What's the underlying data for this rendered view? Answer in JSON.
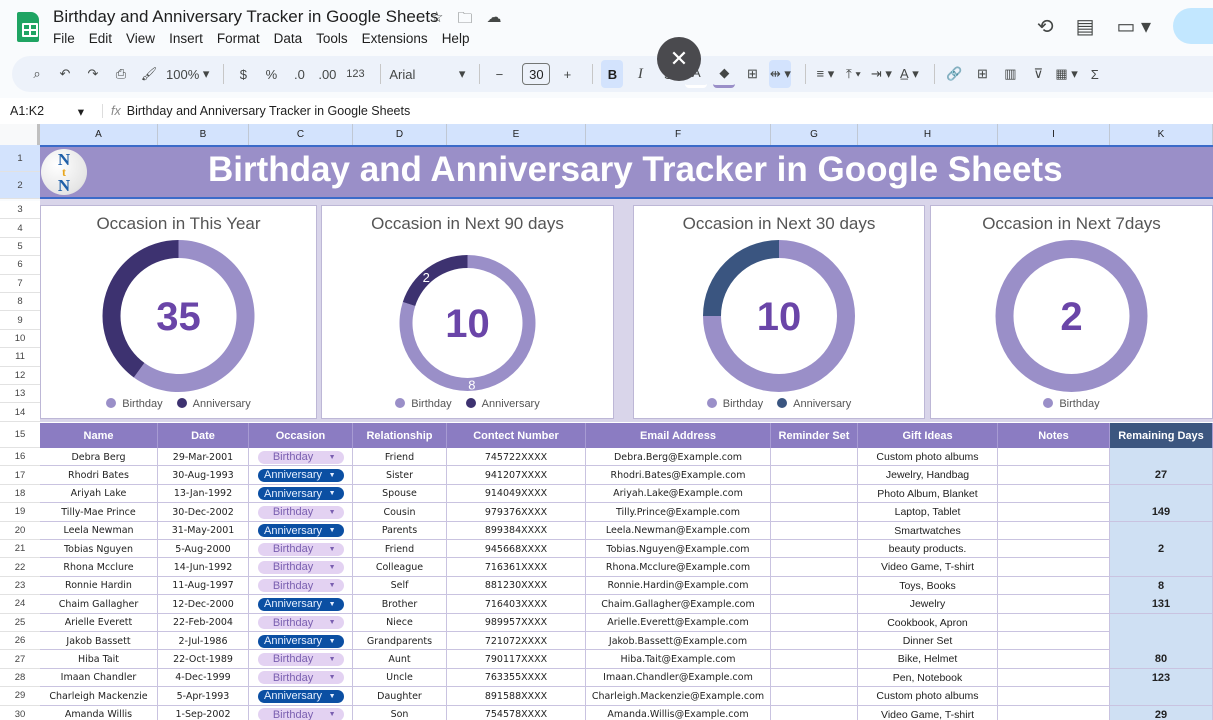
{
  "app": {
    "doc_title": "Birthday and Anniversary Tracker in Google Sheets",
    "title_icons": [
      "star-icon",
      "move-to-folder-icon",
      "cloud-saved-icon"
    ],
    "menu": [
      "File",
      "Edit",
      "View",
      "Insert",
      "Format",
      "Data",
      "Tools",
      "Extensions",
      "Help"
    ],
    "right_icons": [
      "version-history-icon",
      "comments-icon",
      "meet-icon"
    ]
  },
  "toolbar": {
    "zoom": "100%",
    "currency": "$",
    "percent": "%",
    "decrease_decimal": ".0",
    "increase_decimal": ".00",
    "number_format": "123",
    "font": "Arial",
    "font_size": "30",
    "bold": "B",
    "italic": "I",
    "strikethrough": "S",
    "sigma": "Σ",
    "close_bubble": "✕"
  },
  "formula_bar": {
    "name_box": "A1:K2",
    "fx": "fx",
    "content": "Birthday and Anniversary Tracker in Google Sheets"
  },
  "columns": [
    "A",
    "B",
    "C",
    "D",
    "E",
    "F",
    "G",
    "H",
    "I",
    "K"
  ],
  "rows": [
    "1",
    "2",
    "3",
    "4",
    "5",
    "6",
    "7",
    "8",
    "9",
    "10",
    "11",
    "12",
    "13",
    "14",
    "15",
    "16",
    "17",
    "18",
    "19",
    "20",
    "21",
    "22",
    "23",
    "24",
    "25",
    "26",
    "27",
    "28",
    "29",
    "30"
  ],
  "banner": {
    "title": "Birthday and Anniversary Tracker in Google Sheets",
    "logo_letters": [
      "N",
      "t",
      "N"
    ]
  },
  "colors": {
    "birthday": "#9a8fc8",
    "anniversary_dark": "#3d3270",
    "anniversary_blue": "#3a5580",
    "center_number": "#6a45a8",
    "header_purple": "#8b7cc2",
    "remaining_header": "#3c567f"
  },
  "chart_data": [
    {
      "type": "pie",
      "title": "Occasion in This Year",
      "total_label": "35",
      "categories": [
        "Birthday",
        "Anniversary"
      ],
      "values": [
        21,
        14
      ],
      "legend": [
        "Birthday",
        "Anniversary"
      ],
      "data_labels": [],
      "anniversary_color_key": "anniversary_dark"
    },
    {
      "type": "pie",
      "title": "Occasion in Next 90 days",
      "total_label": "10",
      "categories": [
        "Birthday",
        "Anniversary"
      ],
      "values": [
        8,
        2
      ],
      "legend": [
        "Birthday",
        "Anniversary"
      ],
      "data_labels": [
        "8",
        "2"
      ],
      "anniversary_color_key": "anniversary_dark"
    },
    {
      "type": "pie",
      "title": "Occasion in Next 30 days",
      "total_label": "10",
      "categories": [
        "Birthday",
        "Anniversary"
      ],
      "values": [
        7.5,
        2.5
      ],
      "legend": [
        "Birthday",
        "Anniversary"
      ],
      "data_labels": [],
      "anniversary_color_key": "anniversary_blue"
    },
    {
      "type": "pie",
      "title": "Occasion in Next 7days",
      "total_label": "2",
      "categories": [
        "Birthday"
      ],
      "values": [
        2
      ],
      "legend": [
        "Birthday"
      ],
      "data_labels": [],
      "anniversary_color_key": "anniversary_dark"
    }
  ],
  "table": {
    "headers": [
      "Name",
      "Date",
      "Occasion",
      "Relationship",
      "Contect Number",
      "Email Address",
      "Reminder Set",
      "Gift Ideas",
      "Notes",
      "Remaining Days"
    ],
    "rows": [
      {
        "name": "Debra Berg",
        "date": "29-Mar-2001",
        "occasion": "Birthday",
        "relationship": "Friend",
        "contact": "745722XXXX",
        "email": "Debra.Berg@Example.com",
        "reminder": "",
        "gift": "Custom photo albums",
        "notes": "",
        "remaining": ""
      },
      {
        "name": "Rhodri Bates",
        "date": "30-Aug-1993",
        "occasion": "Anniversary",
        "relationship": "Sister",
        "contact": "941207XXXX",
        "email": "Rhodri.Bates@Example.com",
        "reminder": "",
        "gift": "Jewelry, Handbag",
        "notes": "",
        "remaining": "27"
      },
      {
        "name": "Ariyah Lake",
        "date": "13-Jan-1992",
        "occasion": "Anniversary",
        "relationship": "Spouse",
        "contact": "914049XXXX",
        "email": "Ariyah.Lake@Example.com",
        "reminder": "",
        "gift": "Photo Album, Blanket",
        "notes": "",
        "remaining": ""
      },
      {
        "name": "Tilly-Mae Prince",
        "date": "30-Dec-2002",
        "occasion": "Birthday",
        "relationship": "Cousin",
        "contact": "979376XXXX",
        "email": "Tilly.Prince@Example.com",
        "reminder": "",
        "gift": "Laptop, Tablet",
        "notes": "",
        "remaining": "149"
      },
      {
        "name": "Leela Newman",
        "date": "31-May-2001",
        "occasion": "Anniversary",
        "relationship": "Parents",
        "contact": "899384XXXX",
        "email": "Leela.Newman@Example.com",
        "reminder": "",
        "gift": "Smartwatches",
        "notes": "",
        "remaining": ""
      },
      {
        "name": "Tobias Nguyen",
        "date": "5-Aug-2000",
        "occasion": "Birthday",
        "relationship": "Friend",
        "contact": "945668XXXX",
        "email": "Tobias.Nguyen@Example.com",
        "reminder": "",
        "gift": "beauty products.",
        "notes": "",
        "remaining": "2"
      },
      {
        "name": "Rhona Mcclure",
        "date": "14-Jun-1992",
        "occasion": "Birthday",
        "relationship": "Colleague",
        "contact": "716361XXXX",
        "email": "Rhona.Mcclure@Example.com",
        "reminder": "",
        "gift": "Video Game, T-shirt",
        "notes": "",
        "remaining": ""
      },
      {
        "name": "Ronnie Hardin",
        "date": "11-Aug-1997",
        "occasion": "Birthday",
        "relationship": "Self",
        "contact": "881230XXXX",
        "email": "Ronnie.Hardin@Example.com",
        "reminder": "",
        "gift": "Toys, Books",
        "notes": "",
        "remaining": "8"
      },
      {
        "name": "Chaim Gallagher",
        "date": "12-Dec-2000",
        "occasion": "Anniversary",
        "relationship": "Brother",
        "contact": "716403XXXX",
        "email": "Chaim.Gallagher@Example.com",
        "reminder": "",
        "gift": "Jewelry",
        "notes": "",
        "remaining": "131"
      },
      {
        "name": "Arielle Everett",
        "date": "22-Feb-2004",
        "occasion": "Birthday",
        "relationship": "Niece",
        "contact": "989957XXXX",
        "email": "Arielle.Everett@Example.com",
        "reminder": "",
        "gift": "Cookbook, Apron",
        "notes": "",
        "remaining": ""
      },
      {
        "name": "Jakob Bassett",
        "date": "2-Jul-1986",
        "occasion": "Anniversary",
        "relationship": "Grandparents",
        "contact": "721072XXXX",
        "email": "Jakob.Bassett@Example.com",
        "reminder": "",
        "gift": "Dinner Set",
        "notes": "",
        "remaining": ""
      },
      {
        "name": "Hiba Tait",
        "date": "22-Oct-1989",
        "occasion": "Birthday",
        "relationship": "Aunt",
        "contact": "790117XXXX",
        "email": "Hiba.Tait@Example.com",
        "reminder": "",
        "gift": "Bike, Helmet",
        "notes": "",
        "remaining": "80"
      },
      {
        "name": "Imaan Chandler",
        "date": "4-Dec-1999",
        "occasion": "Birthday",
        "relationship": "Uncle",
        "contact": "763355XXXX",
        "email": "Imaan.Chandler@Example.com",
        "reminder": "",
        "gift": "Pen, Notebook",
        "notes": "",
        "remaining": "123"
      },
      {
        "name": "Charleigh Mackenzie",
        "date": "5-Apr-1993",
        "occasion": "Anniversary",
        "relationship": "Daughter",
        "contact": "891588XXXX",
        "email": "Charleigh.Mackenzie@Example.com",
        "reminder": "",
        "gift": "Custom photo albums",
        "notes": "",
        "remaining": ""
      },
      {
        "name": "Amanda Willis",
        "date": "1-Sep-2002",
        "occasion": "Birthday",
        "relationship": "Son",
        "contact": "754578XXXX",
        "email": "Amanda.Willis@Example.com",
        "reminder": "",
        "gift": "Video Game, T-shirt",
        "notes": "",
        "remaining": "29"
      }
    ]
  }
}
